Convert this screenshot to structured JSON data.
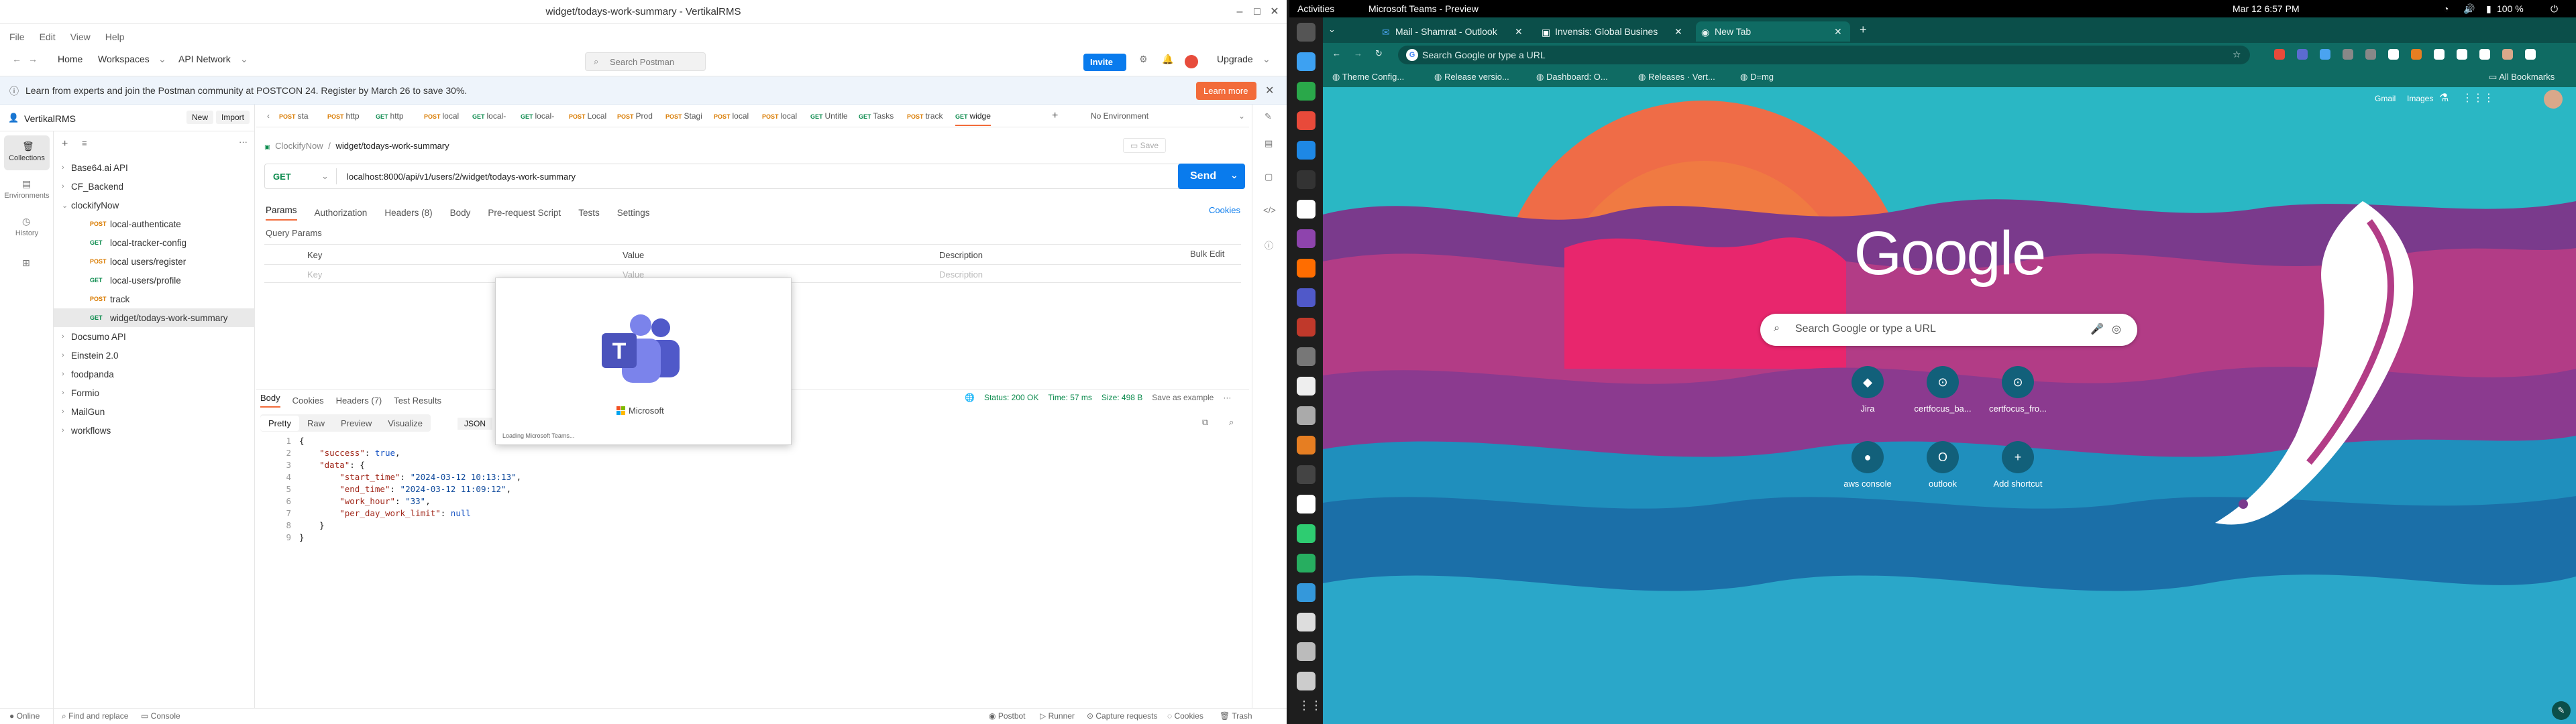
{
  "postman": {
    "window_title": "widget/todays-work-summary - VertikalRMS",
    "menu": [
      "File",
      "Edit",
      "View",
      "Help"
    ],
    "nav": {
      "home": "Home",
      "workspaces": "Workspaces",
      "network": "API Network",
      "search_placeholder": "Search Postman",
      "invite": "Invite",
      "upgrade": "Upgrade"
    },
    "banner": {
      "text": "Learn from experts and join the Postman community at POSTCON 24. Register by March 26 to save 30%.",
      "button": "Learn more"
    },
    "rail": [
      {
        "label": "Collections"
      },
      {
        "label": "Environments"
      },
      {
        "label": "History"
      }
    ],
    "workspace": {
      "name": "VertikalRMS",
      "new": "New",
      "import": "Import"
    },
    "tree": [
      {
        "label": "Base64.ai API",
        "level": 0,
        "method": ""
      },
      {
        "label": "CF_Backend",
        "level": 0,
        "method": ""
      },
      {
        "label": "clockifyNow",
        "level": 0,
        "method": "",
        "open": true
      },
      {
        "label": "local-authenticate",
        "level": 1,
        "method": "POST"
      },
      {
        "label": "local-tracker-config",
        "level": 1,
        "method": "GET"
      },
      {
        "label": "local users/register",
        "level": 1,
        "method": "POST"
      },
      {
        "label": "local-users/profile",
        "level": 1,
        "method": "GET"
      },
      {
        "label": "track",
        "level": 1,
        "method": "POST"
      },
      {
        "label": "widget/todays-work-summary",
        "level": 2,
        "method": "GET",
        "selected": true
      },
      {
        "label": "Docsumo API",
        "level": 0,
        "method": ""
      },
      {
        "label": "Einstein 2.0",
        "level": 0,
        "method": ""
      },
      {
        "label": "foodpanda",
        "level": 0,
        "method": ""
      },
      {
        "label": "Formio",
        "level": 0,
        "method": ""
      },
      {
        "label": "MailGun",
        "level": 0,
        "method": ""
      },
      {
        "label": "workflows",
        "level": 0,
        "method": ""
      }
    ],
    "tabs": [
      {
        "m": "POST",
        "l": "sta"
      },
      {
        "m": "POST",
        "l": "http"
      },
      {
        "m": "GET",
        "l": "http"
      },
      {
        "m": "POST",
        "l": "local"
      },
      {
        "m": "GET",
        "l": "local-"
      },
      {
        "m": "GET",
        "l": "local-"
      },
      {
        "m": "POST",
        "l": "Local"
      },
      {
        "m": "POST",
        "l": "Prod"
      },
      {
        "m": "POST",
        "l": "Stagi"
      },
      {
        "m": "POST",
        "l": "local"
      },
      {
        "m": "POST",
        "l": "local"
      },
      {
        "m": "GET",
        "l": "Untitle"
      },
      {
        "m": "GET",
        "l": "Tasks"
      },
      {
        "m": "POST",
        "l": "track"
      },
      {
        "m": "GET",
        "l": "widge"
      }
    ],
    "environment": "No Environment",
    "breadcrumb": {
      "parent": "ClockifyNow",
      "sep": "/",
      "current": "widget/todays-work-summary"
    },
    "save": "Save",
    "request": {
      "method": "GET",
      "url": "localhost:8000/api/v1/users/2/widget/todays-work-summary",
      "send": "Send"
    },
    "subtabs": [
      "Params",
      "Authorization",
      "Headers (8)",
      "Body",
      "Pre-request Script",
      "Tests",
      "Settings"
    ],
    "cookies": "Cookies",
    "query_title": "Query Params",
    "table": {
      "cols": [
        "Key",
        "Value",
        "Description"
      ],
      "bulk": "Bulk Edit",
      "ph_key": "Key",
      "ph_value": "Value",
      "ph_desc": "Description"
    },
    "response": {
      "tabs": [
        "Body",
        "Cookies",
        "Headers (7)",
        "Test Results"
      ],
      "status": "Status: 200 OK",
      "time": "Time: 57 ms",
      "size": "Size: 498 B",
      "save": "Save as example",
      "views": [
        "Pretty",
        "Raw",
        "Preview",
        "Visualize"
      ],
      "format": "JSON"
    },
    "code_lines": [
      [
        [
          "p",
          "{"
        ]
      ],
      [
        [
          "i",
          "    "
        ],
        [
          "k",
          "\"success\""
        ],
        [
          "p",
          ": "
        ],
        [
          "kw",
          "true"
        ],
        [
          "p",
          ","
        ]
      ],
      [
        [
          "i",
          "    "
        ],
        [
          "k",
          "\"data\""
        ],
        [
          "p",
          ": {"
        ]
      ],
      [
        [
          "i",
          "        "
        ],
        [
          "k",
          "\"start_time\""
        ],
        [
          "p",
          ": "
        ],
        [
          "s",
          "\"2024-03-12 10:13:13\""
        ],
        [
          "p",
          ","
        ]
      ],
      [
        [
          "i",
          "        "
        ],
        [
          "k",
          "\"end_time\""
        ],
        [
          "p",
          ": "
        ],
        [
          "s",
          "\"2024-03-12 11:09:12\""
        ],
        [
          "p",
          ","
        ]
      ],
      [
        [
          "i",
          "        "
        ],
        [
          "k",
          "\"work_hour\""
        ],
        [
          "p",
          ": "
        ],
        [
          "s",
          "\"33\""
        ],
        [
          "p",
          ","
        ]
      ],
      [
        [
          "i",
          "        "
        ],
        [
          "k",
          "\"per_day_work_limit\""
        ],
        [
          "p",
          ": "
        ],
        [
          "kw",
          "null"
        ]
      ],
      [
        [
          "i",
          "    "
        ],
        [
          "p",
          "}"
        ]
      ],
      [
        [
          "p",
          "}"
        ]
      ]
    ],
    "statusbar": {
      "online": "Online",
      "find": "Find and replace",
      "console": "Console",
      "postbot": "Postbot",
      "runner": "Runner",
      "capture": "Capture requests",
      "cookies": "Cookies",
      "trash": "Trash"
    },
    "teams_splash": {
      "brand": "Microsoft",
      "loading": "Loading Microsoft Teams..."
    }
  },
  "gnome": {
    "activities": "Activities",
    "app": "Microsoft Teams - Preview",
    "clock": "Mar 12  6:57 PM",
    "battery": "100 %"
  },
  "chrome": {
    "tabs": [
      {
        "label": "Mail - Shamrat - Outlook"
      },
      {
        "label": "Invensis: Global Busines"
      },
      {
        "label": "New Tab",
        "active": true
      }
    ],
    "omnibox": "Search Google or type a URL",
    "bookmarks": [
      "Theme Config...",
      "Release versio...",
      "Dashboard: O...",
      "Releases · Vert...",
      "D=mg"
    ],
    "all_bookmarks": "All Bookmarks",
    "top_links": [
      "Gmail",
      "Images"
    ],
    "logo": "Google",
    "search_placeholder": "Search Google or type a URL",
    "shortcuts": [
      {
        "label": "Jira",
        "icon": "jira-icon"
      },
      {
        "label": "certfocus_ba...",
        "icon": "github-icon"
      },
      {
        "label": "certfocus_fro...",
        "icon": "github-icon"
      },
      {
        "label": "aws console",
        "icon": "aws-icon"
      },
      {
        "label": "outlook",
        "icon": "outlook-icon"
      },
      {
        "label": "Add shortcut",
        "icon": "plus-icon"
      }
    ]
  }
}
